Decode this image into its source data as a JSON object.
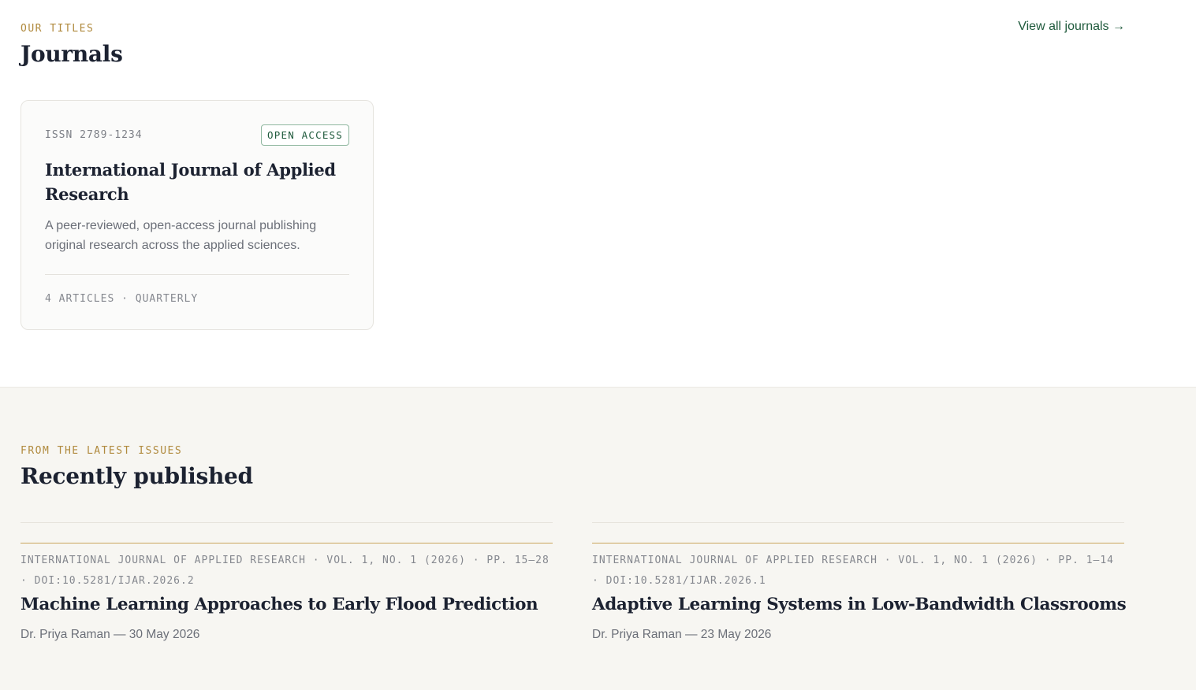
{
  "journals_section": {
    "eyebrow": "OUR TITLES",
    "heading": "Journals",
    "view_all": "View all journals →"
  },
  "journal_card": {
    "issn": "ISSN 2789-1234",
    "badge": "OPEN ACCESS",
    "title": "International Journal of Applied Research",
    "description": "A peer-reviewed, open-access journal publishing original research across the applied sciences.",
    "meta": "4 ARTICLES · QUARTERLY"
  },
  "recent_section": {
    "eyebrow": "FROM THE LATEST ISSUES",
    "heading": "Recently published",
    "articles": [
      {
        "meta": "INTERNATIONAL JOURNAL OF APPLIED RESEARCH · VOL. 1, NO. 1 (2026) · PP. 15–28 · DOI:10.5281/IJAR.2026.2",
        "title": "Machine Learning Approaches to Early Flood Prediction",
        "byline": "Dr. Priya Raman — 30 May 2026"
      },
      {
        "meta": "INTERNATIONAL JOURNAL OF APPLIED RESEARCH · VOL. 1, NO. 1 (2026) · PP. 1–14 · DOI:10.5281/IJAR.2026.1",
        "title": "Adaptive Learning Systems in Low-Bandwidth Classrooms",
        "byline": "Dr. Priya Raman — 23 May 2026"
      }
    ]
  },
  "colors": {
    "accent_gold": "#b08a3e",
    "brand_green": "#1f5a3c",
    "heading": "#1c2231",
    "section_bg": "#f7f6f2"
  }
}
